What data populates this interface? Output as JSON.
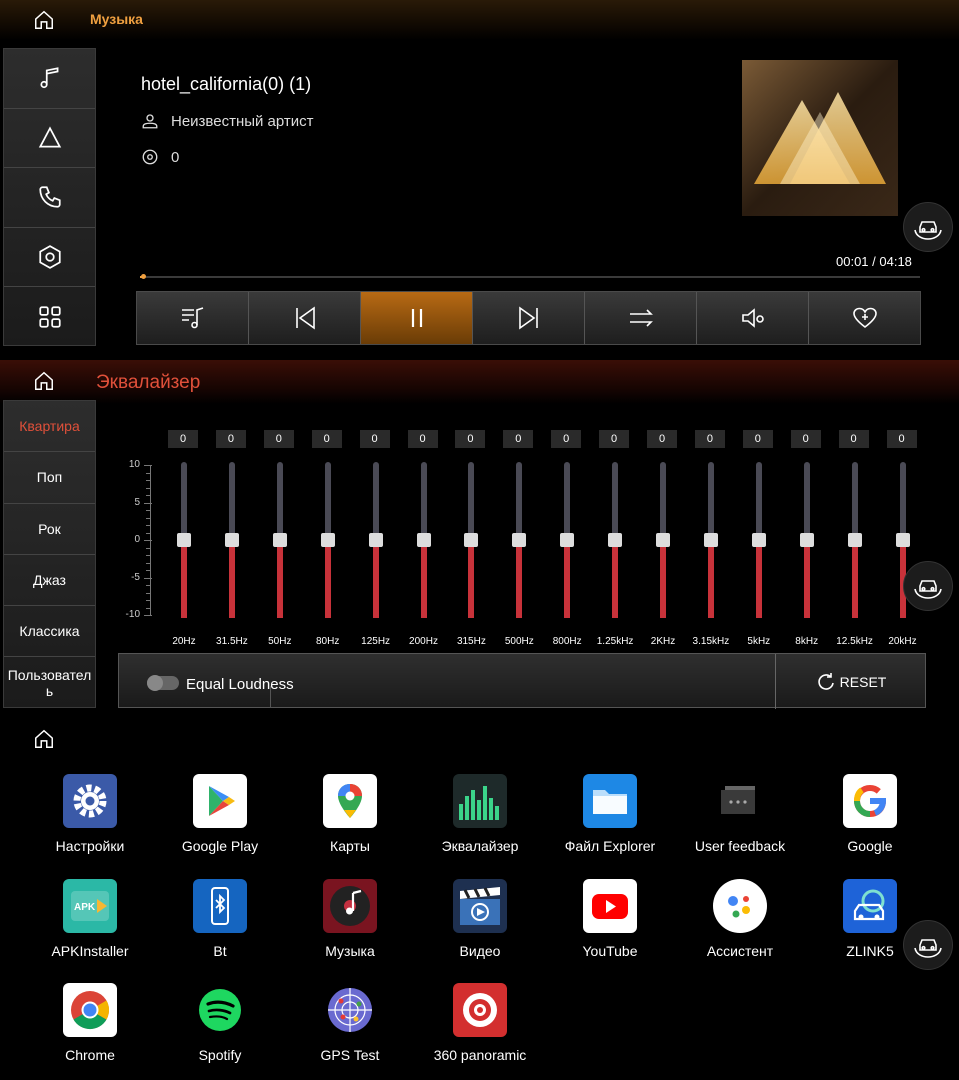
{
  "music": {
    "app_title": "Музыка",
    "track_title": "hotel_california(0) (1)",
    "artist": "Неизвестный артист",
    "album": "0",
    "time": "00:01 / 04:18",
    "progress_fraction": 0.004,
    "side_icons": [
      "music-note-icon",
      "navigation-icon",
      "phone-icon",
      "settings-hexagon-icon",
      "apps-grid-icon"
    ],
    "controls": [
      "playlist-icon",
      "previous-icon",
      "pause-icon",
      "next-icon",
      "shuffle-icon",
      "sound-settings-icon",
      "favorite-icon"
    ],
    "accent_color": "#f0a040"
  },
  "equalizer": {
    "title": "Эквалайзер",
    "presets": [
      "Квартира",
      "Поп",
      "Рок",
      "Джаз",
      "Классика",
      "Пользователь"
    ],
    "active_preset": "Квартира",
    "scale_labels": [
      "10",
      "5",
      "0",
      "-5",
      "-10"
    ],
    "bands": [
      {
        "freq": "20Hz",
        "value": "0"
      },
      {
        "freq": "31.5Hz",
        "value": "0"
      },
      {
        "freq": "50Hz",
        "value": "0"
      },
      {
        "freq": "80Hz",
        "value": "0"
      },
      {
        "freq": "125Hz",
        "value": "0"
      },
      {
        "freq": "200Hz",
        "value": "0"
      },
      {
        "freq": "315Hz",
        "value": "0"
      },
      {
        "freq": "500Hz",
        "value": "0"
      },
      {
        "freq": "800Hz",
        "value": "0"
      },
      {
        "freq": "1.25kHz",
        "value": "0"
      },
      {
        "freq": "2KHz",
        "value": "0"
      },
      {
        "freq": "3.15kHz",
        "value": "0"
      },
      {
        "freq": "5kHz",
        "value": "0"
      },
      {
        "freq": "8kHz",
        "value": "0"
      },
      {
        "freq": "12.5kHz",
        "value": "0"
      },
      {
        "freq": "20kHz",
        "value": "0"
      }
    ],
    "equal_loudness_label": "Equal Loudness",
    "equal_loudness_on": false,
    "reset_label": "RESET",
    "accent_color": "#e0503a"
  },
  "launcher": {
    "apps": [
      {
        "label": "Настройки",
        "icon": "settings-icon"
      },
      {
        "label": "Google Play",
        "icon": "google-play-icon"
      },
      {
        "label": "Карты",
        "icon": "maps-icon"
      },
      {
        "label": "Эквалайзер",
        "icon": "equalizer-icon"
      },
      {
        "label": "Файл Explorer",
        "icon": "file-explorer-icon"
      },
      {
        "label": "User feedback",
        "icon": "feedback-icon"
      },
      {
        "label": "Google",
        "icon": "google-icon"
      },
      {
        "label": "APKInstaller",
        "icon": "apk-installer-icon"
      },
      {
        "label": "Bt",
        "icon": "bluetooth-phone-icon"
      },
      {
        "label": "Музыка",
        "icon": "music-app-icon"
      },
      {
        "label": "Видео",
        "icon": "video-icon"
      },
      {
        "label": "YouTube",
        "icon": "youtube-icon"
      },
      {
        "label": "Ассистент",
        "icon": "assistant-icon"
      },
      {
        "label": "ZLINK5",
        "icon": "zlink-icon"
      },
      {
        "label": "Chrome",
        "icon": "chrome-icon"
      },
      {
        "label": "Spotify",
        "icon": "spotify-icon"
      },
      {
        "label": "GPS Test",
        "icon": "gps-test-icon"
      },
      {
        "label": "360 panoramic",
        "icon": "panoramic-camera-icon"
      }
    ]
  }
}
